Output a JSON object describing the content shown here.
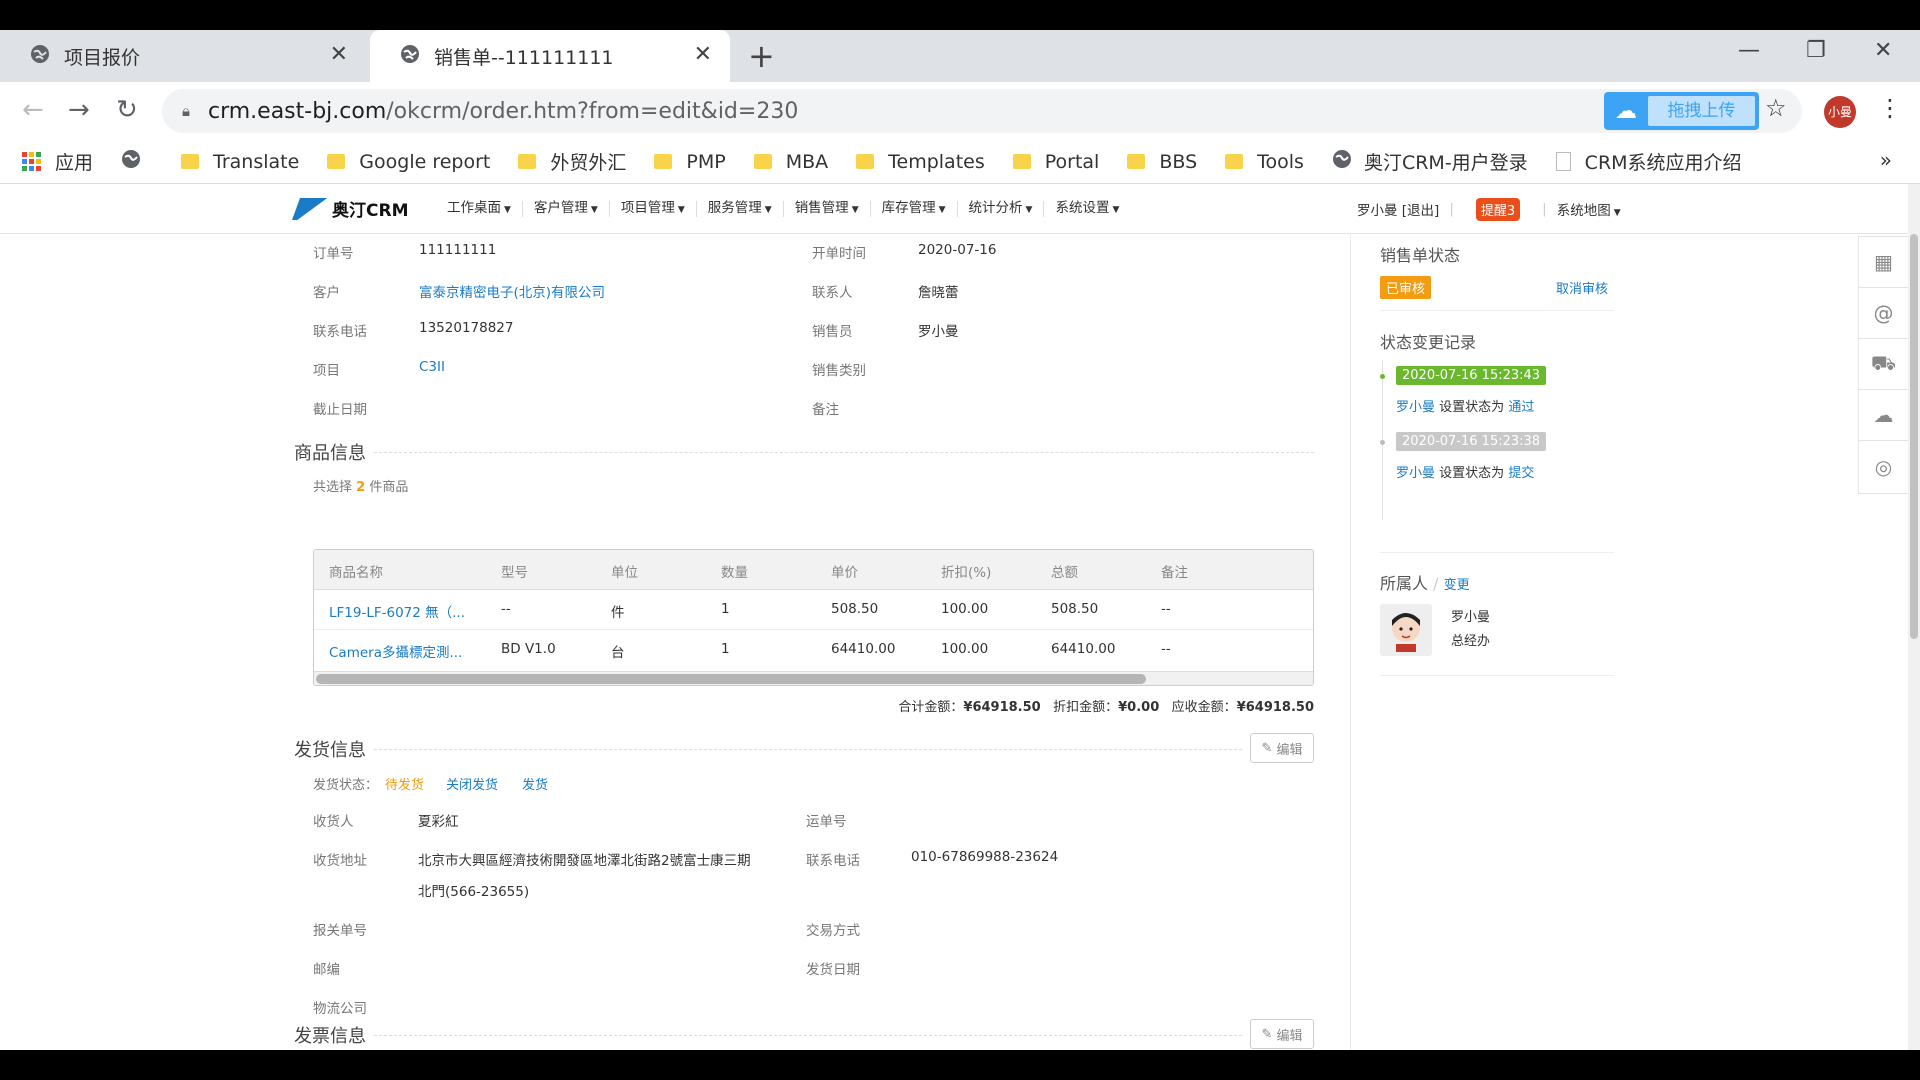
{
  "browser": {
    "tabs": [
      {
        "title": "项目报价",
        "active": false
      },
      {
        "title": "销售单--111111111",
        "active": true
      }
    ],
    "url_host": "crm.east-bj.com",
    "url_path": "/okcrm/order.htm?from=edit&id=230",
    "upload_label": "拖拽上传",
    "profile_label": "小曼",
    "bookmarks": [
      "应用",
      "Translate",
      "Google report",
      "外贸外汇",
      "PMP",
      "MBA",
      "Templates",
      "Portal",
      "BBS",
      "Tools",
      "奥汀CRM-用户登录",
      "CRM系统应用介绍"
    ]
  },
  "crm": {
    "logo": "奥汀CRM",
    "menu": [
      "工作桌面",
      "客户管理",
      "项目管理",
      "服务管理",
      "销售管理",
      "库存管理",
      "统计分析",
      "系统设置"
    ],
    "user": "罗小曼 [退出]",
    "remind": "提醒3",
    "sitemap": "系统地图"
  },
  "order": {
    "order_no_label": "订单号",
    "order_no": "111111111",
    "open_time_label": "开单时间",
    "open_time": "2020-07-16",
    "customer_label": "客户",
    "customer": "富泰京精密电子(北京)有限公司",
    "contact_label": "联系人",
    "contact": "詹晓蕾",
    "phone_label": "联系电话",
    "phone": "13520178827",
    "sales_label": "销售员",
    "sales": "罗小曼",
    "project_label": "项目",
    "project": "C3II",
    "sales_type_label": "销售类别",
    "deadline_label": "截止日期",
    "remark_label": "备注"
  },
  "goods": {
    "section_title": "商品信息",
    "count_prefix": "共选择",
    "count": "2",
    "count_suffix": "件商品",
    "headers": [
      "商品名称",
      "型号",
      "单位",
      "数量",
      "单价",
      "折扣(%)",
      "总额",
      "备注"
    ],
    "rows": [
      [
        "LF19-LF-6072 無（...",
        "--",
        "件",
        "1",
        "508.50",
        "100.00",
        "508.50",
        "--"
      ],
      [
        "Camera多攝標定測...",
        "BD V1.0",
        "台",
        "1",
        "64410.00",
        "100.00",
        "64410.00",
        "--"
      ]
    ],
    "total_label": "合计金额：",
    "total": "¥64918.50",
    "discount_label": "折扣金额：",
    "discount": "¥0.00",
    "due_label": "应收金额：",
    "due": "¥64918.50"
  },
  "shipping": {
    "section_title": "发货信息",
    "edit_label": "编辑",
    "status_label": "发货状态：",
    "status": "待发货",
    "close_action": "关闭发货",
    "ship_action": "发货",
    "receiver_label": "收货人",
    "receiver": "夏彩紅",
    "waybill_label": "运单号",
    "address_label": "收货地址",
    "address_line1": "北京市大興區經濟技術開發區地澤北街路2號富士康三期",
    "address_line2": "北門(566-23655)",
    "contact_phone_label": "联系电话",
    "contact_phone": "010-67869988-23624",
    "customs_label": "报关单号",
    "trade_label": "交易方式",
    "zip_label": "邮编",
    "ship_date_label": "发货日期",
    "logistics_label": "物流公司"
  },
  "invoice": {
    "section_title": "发票信息",
    "edit_label": "编辑"
  },
  "status_panel": {
    "title": "销售单状态",
    "status": "已审核",
    "cancel_action": "取消审核",
    "history_title": "状态变更记录",
    "history": [
      {
        "time": "2020-07-16 15:23:43",
        "user": "罗小曼",
        "text": "设置状态为",
        "state": "通过"
      },
      {
        "time": "2020-07-16 15:23:38",
        "user": "罗小曼",
        "text": "设置状态为",
        "state": "提交"
      }
    ],
    "owner_title": "所属人",
    "owner_change": "变更",
    "owner_name": "罗小曼",
    "owner_dept": "总经办"
  },
  "colors": {
    "accent": "#1a7bc7",
    "approved": "#f39c12",
    "green": "#6ab82e",
    "remind": "#e94e1b"
  }
}
